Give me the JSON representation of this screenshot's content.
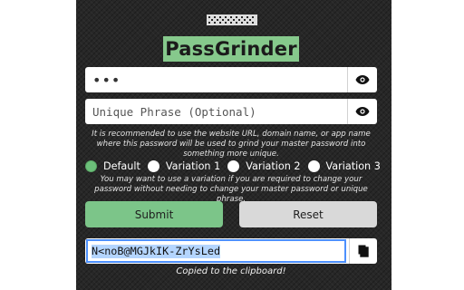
{
  "app": {
    "name": "PassGrinder"
  },
  "password_field": {
    "value": "•••",
    "reveal_icon": "eye-icon"
  },
  "phrase_field": {
    "placeholder": "Unique Phrase (Optional)",
    "reveal_icon": "eye-icon"
  },
  "phrase_help": "It is recommended to use the website URL, domain name, or app name where this password will be used to grind your master password into something more unique.",
  "variations": {
    "selected": "Default",
    "options": [
      "Default",
      "Variation 1",
      "Variation 2",
      "Variation 3"
    ]
  },
  "variation_help": "You may want to use a variation if you are required to change your password without needing to change your master password or unique phrase.",
  "actions": {
    "submit": "Submit",
    "reset": "Reset"
  },
  "result": {
    "value": "N<noB@MGJkIK-ZrYsLed",
    "copy_icon": "copy-icon"
  },
  "status": "Copied to the clipboard!",
  "colors": {
    "accent": "#86c98c",
    "submit": "#7cc589",
    "reset": "#d9d9d9",
    "panel": "#272727",
    "focus": "#4d90fe"
  }
}
